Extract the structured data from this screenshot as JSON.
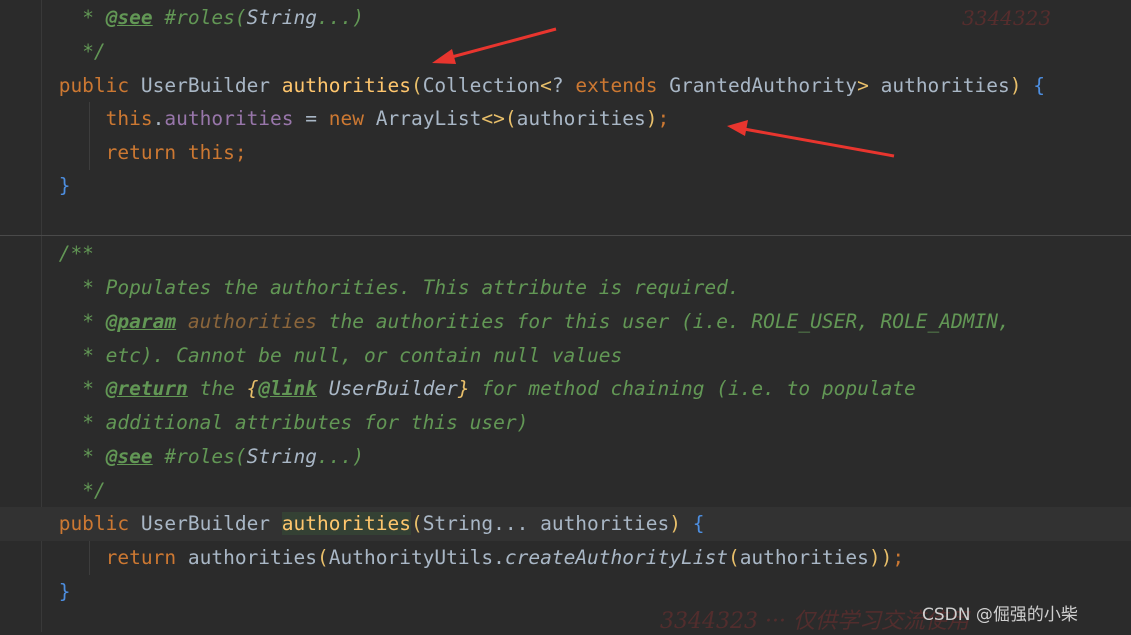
{
  "editor": {
    "lines": [
      {
        "prefix": " * ",
        "see_tag": "@see",
        "rest_a": " #roles(",
        "string_type": "String",
        "rest_b": "...)"
      },
      {
        "text": " */"
      },
      {
        "public": "public",
        "type": "UserBuilder",
        "method": "authorities",
        "open": "(",
        "param_type": "Collection",
        "generic_open": "<",
        "wildcard": "? ",
        "extends": "extends",
        "bound": " GrantedAuthority",
        "generic_close": ">",
        "param_name": " authorities",
        "close": ")",
        "brace": "{"
      },
      {
        "this": "this",
        "dot": ".",
        "field": "authorities",
        "assign": " = ",
        "new": "new",
        "ctor": " ArrayList",
        "diamond": "<>",
        "open": "(",
        "arg": "authorities",
        "close": ")",
        "semi": ";"
      },
      {
        "return": "return",
        "this": " this",
        "semi": ";"
      },
      {
        "brace": "}"
      },
      {
        "text": "/**"
      },
      {
        "text": " * Populates the authorities. This attribute is required."
      },
      {
        "prefix": " * ",
        "param_tag": "@param",
        "param_name": " authorities",
        "text": " the authorities for this user (i.e. ROLE_USER, ROLE_ADMIN,"
      },
      {
        "text": " * etc). Cannot be null, or contain null values"
      },
      {
        "prefix": " * ",
        "return_tag": "@return",
        "a": " the ",
        "lbrace": "{",
        "link_tag": "@link",
        "link_target": " UserBuilder",
        "rbrace": "}",
        "b": " for method chaining (i.e. to populate"
      },
      {
        "text": " * additional attributes for this user)"
      },
      {
        "prefix": " * ",
        "see_tag": "@see",
        "rest_a": " #roles(",
        "string_type": "String",
        "rest_b": "...)"
      },
      {
        "text": " */"
      },
      {
        "public": "public",
        "type": "UserBuilder",
        "method": "authorities",
        "open": "(",
        "param": "String... authorities",
        "close": ")",
        "brace": "{"
      },
      {
        "return": "return",
        "call": " authorities",
        "open": "(",
        "util": "AuthorityUtils.",
        "static_method": "createAuthorityList",
        "open2": "(",
        "arg": "authorities",
        "close2": ")",
        "close": ")",
        "semi": ";"
      },
      {
        "brace": "}"
      }
    ]
  },
  "watermark": {
    "csdn": "CSDN @倔强的小柴",
    "top": "3344323",
    "bottom": "3344323 ··· 仅供学习交流使用"
  },
  "colors": {
    "background": "#2b2b2b",
    "comment": "#629755",
    "keyword": "#cc7832",
    "method": "#ffc66d",
    "field": "#9876aa",
    "default": "#a9b7c6",
    "arrow": "#e8352e"
  }
}
